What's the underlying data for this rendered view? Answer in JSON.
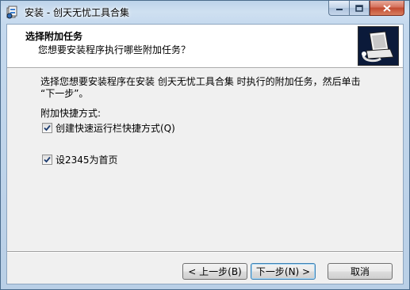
{
  "window": {
    "title": "安装 - 创天无忧工具合集",
    "minimize_icon": "minimize-icon",
    "maximize_icon": "maximize-icon",
    "close_icon": "close-icon"
  },
  "header": {
    "title": "选择附加任务",
    "subtitle": "您想要安装程序执行哪些附加任务？",
    "image_icon": "installer-computer-icon"
  },
  "body": {
    "description_line1": "选择您想要安装程序在安装 创天无忧工具合集 时执行的附加任务，然后单击",
    "description_line2": "“下一步”。",
    "group_label": "附加快捷方式:",
    "tasks": [
      {
        "label": "创建快速运行栏快捷方式(Q)",
        "checked": true
      },
      {
        "label": "设2345为首页",
        "checked": true
      }
    ]
  },
  "buttons": {
    "back": "< 上一步(B)",
    "next": "下一步(N) >",
    "cancel": "取消"
  },
  "colors": {
    "title_bar": "#c5d9ee",
    "close_button": "#c24a30",
    "dialog_bg": "#f0f0f0",
    "header_bg": "#ffffff"
  }
}
